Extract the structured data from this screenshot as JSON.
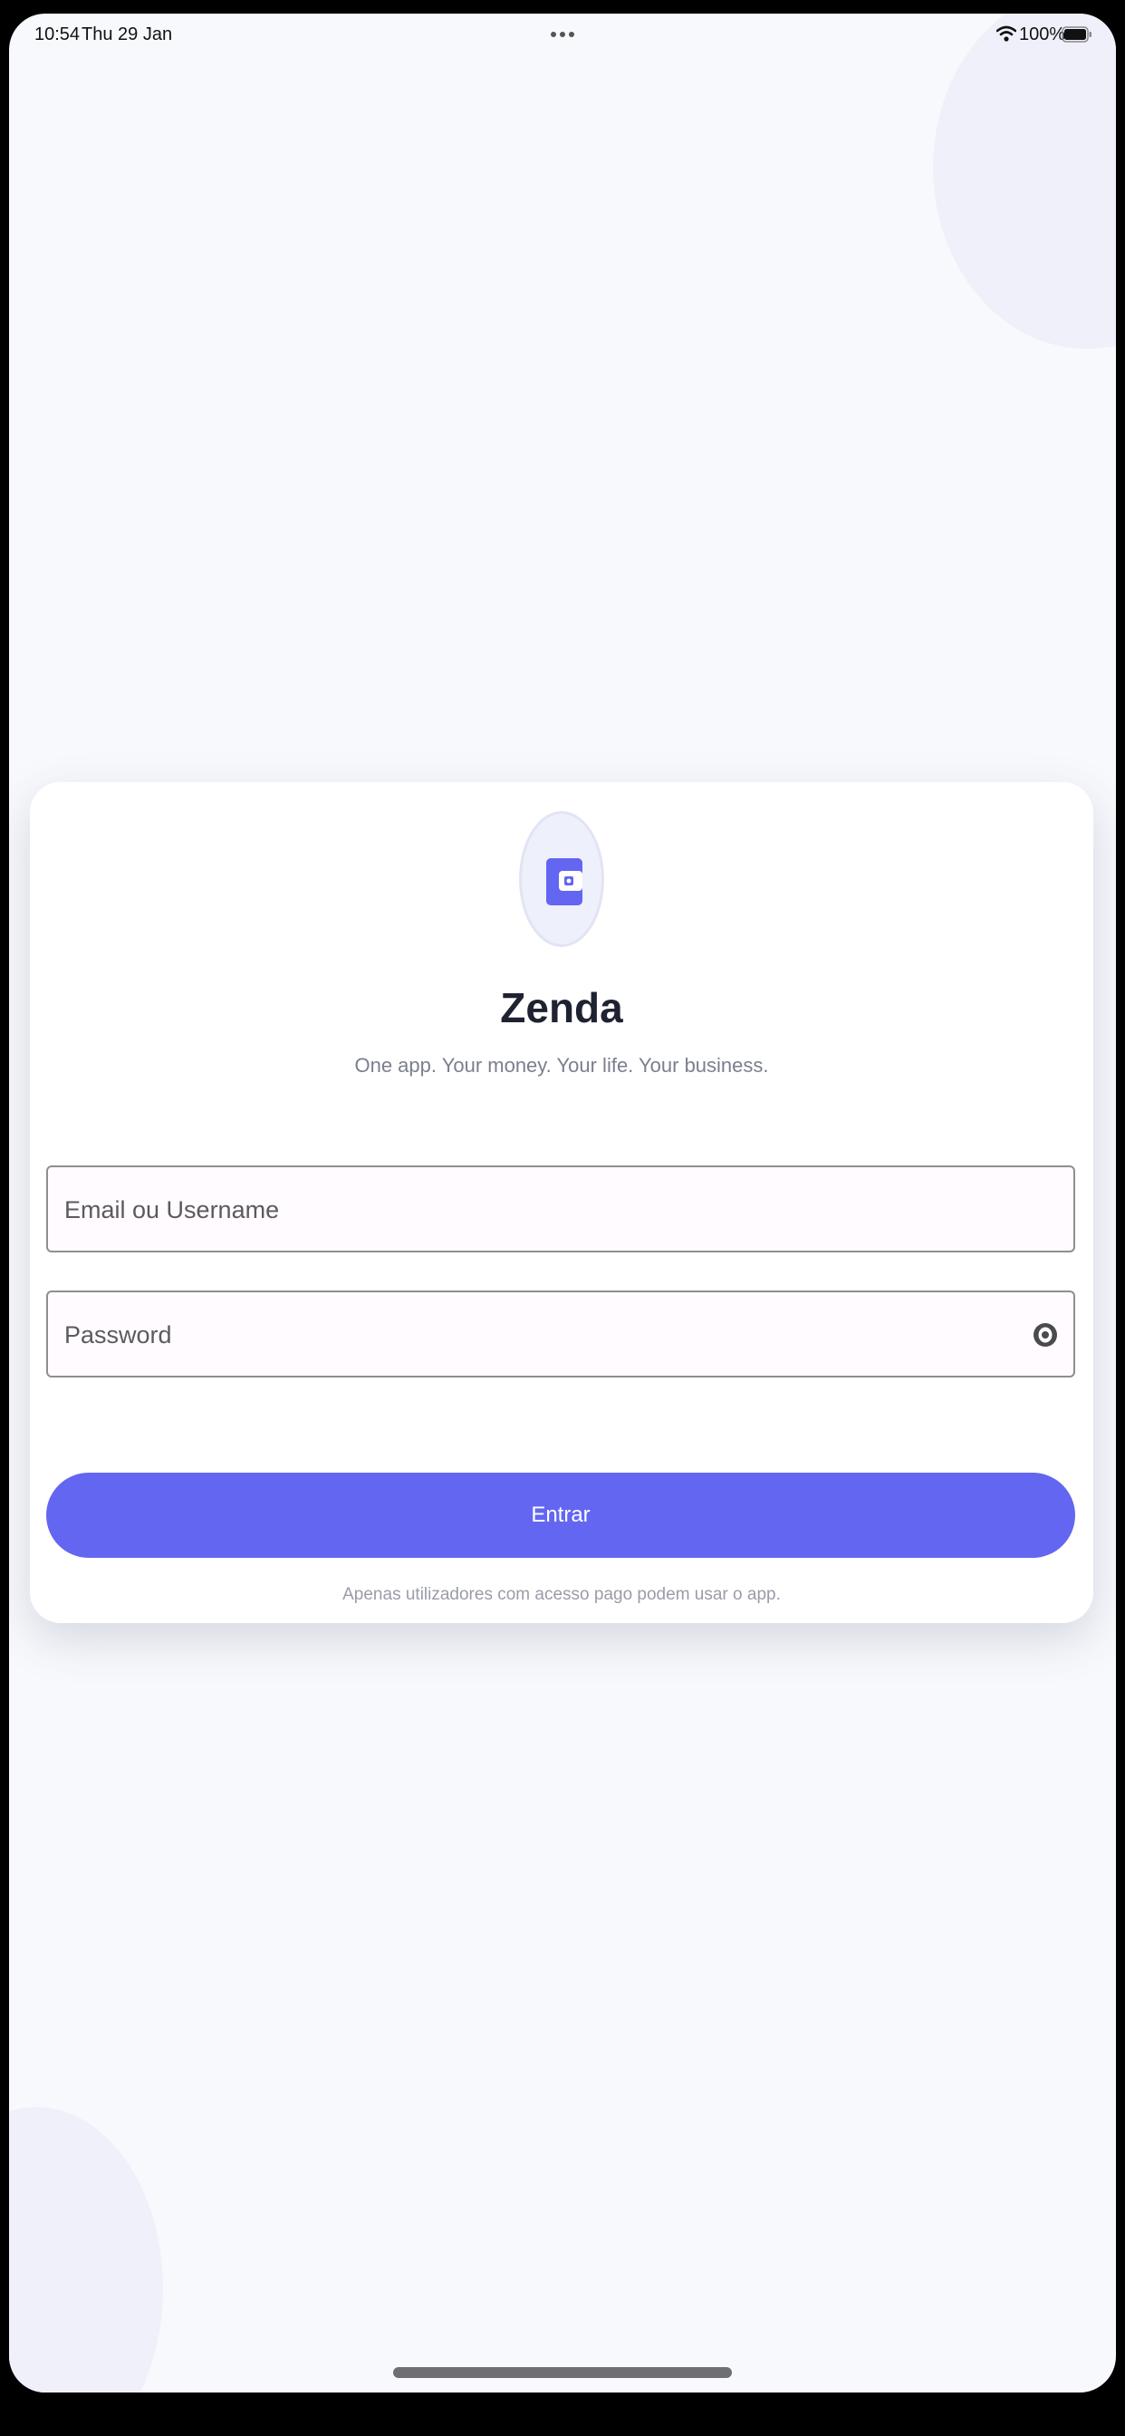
{
  "status_bar": {
    "time": "10:54",
    "date": "Thu 29 Jan",
    "battery": "100%",
    "icons": [
      "wifi-icon",
      "battery-icon",
      "more-dots-icon"
    ]
  },
  "login": {
    "logo_icon": "wallet-icon",
    "title": "Zenda",
    "subtitle": "One app. Your money. Your life. Your business.",
    "email_placeholder": "Email ou Username",
    "password_placeholder": "Password",
    "password_toggle_icon": "eye-icon",
    "submit_label": "Entrar",
    "footer_note": "Apenas utilizadores com acesso pago podem usar o app."
  },
  "colors": {
    "accent": "#6366f1",
    "background": "#f8f9fc",
    "card": "#ffffff",
    "title": "#1f2230",
    "muted": "#7b7f8e"
  }
}
